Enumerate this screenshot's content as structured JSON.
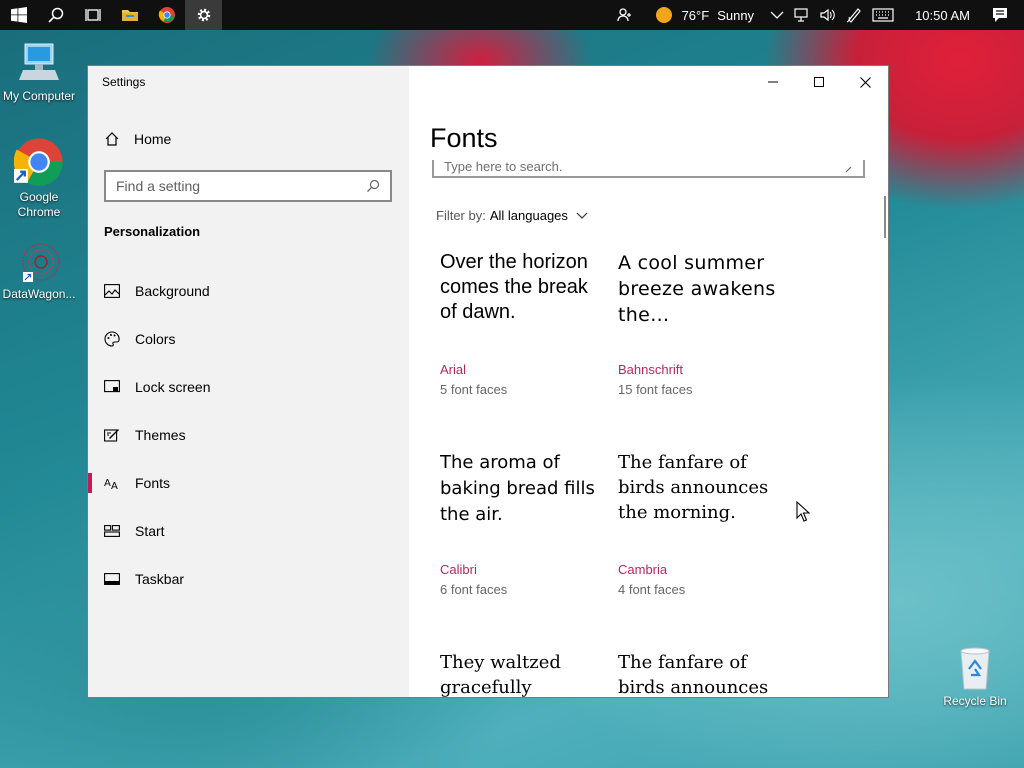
{
  "taskbar": {
    "weather_temp": "76°F",
    "weather_desc": "Sunny",
    "clock": "10:50 AM"
  },
  "desktop": {
    "icons": [
      {
        "label": "My Computer"
      },
      {
        "label": "Google Chrome"
      },
      {
        "label": "DataWagon..."
      },
      {
        "label": "Recycle Bin"
      }
    ]
  },
  "window": {
    "title": "Settings"
  },
  "sidebar": {
    "home_label": "Home",
    "search_placeholder": "Find a setting",
    "section_title": "Personalization",
    "items": [
      {
        "label": "Background",
        "icon": "picture-icon"
      },
      {
        "label": "Colors",
        "icon": "palette-icon"
      },
      {
        "label": "Lock screen",
        "icon": "lock-screen-icon"
      },
      {
        "label": "Themes",
        "icon": "themes-icon"
      },
      {
        "label": "Fonts",
        "icon": "fonts-icon",
        "selected": true
      },
      {
        "label": "Start",
        "icon": "start-icon"
      },
      {
        "label": "Taskbar",
        "icon": "taskbar-icon"
      }
    ]
  },
  "main": {
    "title": "Fonts",
    "search_placeholder": "Type here to search.",
    "filter_label": "Filter by:",
    "filter_value": "All languages",
    "fonts": [
      {
        "preview": "Over the horizon comes the break of dawn.",
        "name": "Arial",
        "faces": "5 font faces"
      },
      {
        "preview": "A cool summer breeze awakens the…",
        "name": "Bahnschrift",
        "faces": "15 font faces"
      },
      {
        "preview": "The aroma of baking bread fills the air.",
        "name": "Calibri",
        "faces": "6 font faces"
      },
      {
        "preview": "The fanfare of birds announces the morning.",
        "name": "Cambria",
        "faces": "4 font faces"
      },
      {
        "preview": "They waltzed gracefully",
        "name": "",
        "faces": ""
      },
      {
        "preview": "The fanfare of birds announces",
        "name": "",
        "faces": ""
      }
    ]
  },
  "colors": {
    "accent": "#c41a5a",
    "font_name": "#b02a5e"
  }
}
